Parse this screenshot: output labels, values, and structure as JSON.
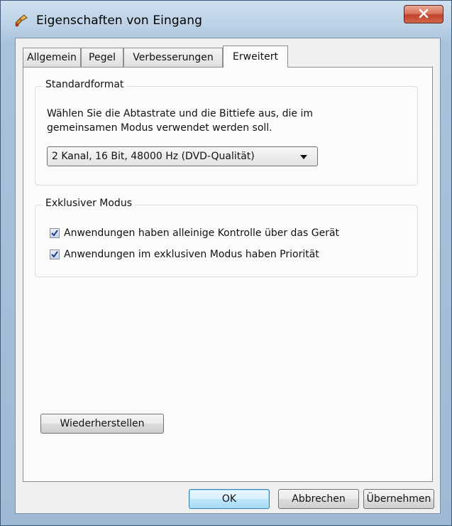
{
  "window": {
    "title": "Eigenschaften von Eingang",
    "app_icon": "speaker-properties-icon",
    "close_icon": "close-icon"
  },
  "tabs": [
    {
      "label": "Allgemein",
      "active": false
    },
    {
      "label": "Pegel",
      "active": false
    },
    {
      "label": "Verbesserungen",
      "active": false
    },
    {
      "label": "Erweitert",
      "active": true
    }
  ],
  "standardformat": {
    "title": "Standardformat",
    "description": "Wählen Sie die Abtastrate und die Bittiefe aus, die im gemeinsamen Modus verwendet werden soll.",
    "selected_format": "2 Kanal, 16 Bit, 48000 Hz (DVD-Qualität)"
  },
  "exclusive": {
    "title": "Exklusiver Modus",
    "checkboxes": [
      {
        "label": "Anwendungen haben alleinige Kontrolle über das Gerät",
        "checked": true
      },
      {
        "label": "Anwendungen im exklusiven Modus haben Priorität",
        "checked": true
      }
    ]
  },
  "buttons": {
    "restore": "Wiederherstellen",
    "ok": "OK",
    "cancel": "Abbrechen",
    "apply": "Übernehmen"
  },
  "colors": {
    "close_button": "#c1422a",
    "default_button_border": "#3c7fb1",
    "checkbox_check": "#1f3d7a"
  }
}
